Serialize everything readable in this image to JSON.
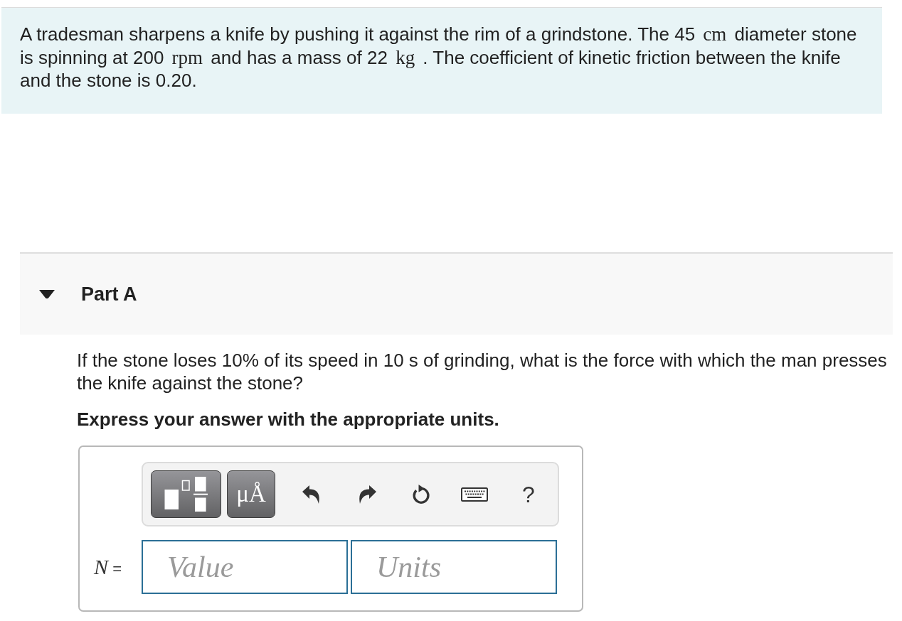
{
  "problem": {
    "segments": [
      {
        "kind": "text",
        "text": "A tradesman sharpens a knife by pushing it against the rim of a grindstone. The 45 "
      },
      {
        "kind": "math",
        "text": "cm"
      },
      {
        "kind": "text",
        "text": " diameter stone is spinning at 200 "
      },
      {
        "kind": "math",
        "text": "rpm"
      },
      {
        "kind": "text",
        "text": " and has a mass of 22 "
      },
      {
        "kind": "math",
        "text": "kg"
      },
      {
        "kind": "text",
        "text": " . The coefficient of kinetic friction between the knife and the stone is 0.20."
      }
    ]
  },
  "part": {
    "title": "Part A",
    "expanded": true,
    "question": "If the stone loses 10% of its speed in 10 s of grinding, what is the force with which the man presses the knife against the stone?",
    "instruction": "Express your answer with the appropriate units.",
    "answer": {
      "toolbar": [
        {
          "kind": "templates"
        },
        {
          "kind": "units",
          "label": "μÅ"
        },
        {
          "kind": "undo"
        },
        {
          "kind": "redo"
        },
        {
          "kind": "reset"
        },
        {
          "kind": "keyboard"
        },
        {
          "kind": "help",
          "label": "?"
        }
      ],
      "label": "*N* =",
      "fields": [
        {
          "placeholder": "Value"
        },
        {
          "placeholder": "Units"
        }
      ]
    }
  }
}
